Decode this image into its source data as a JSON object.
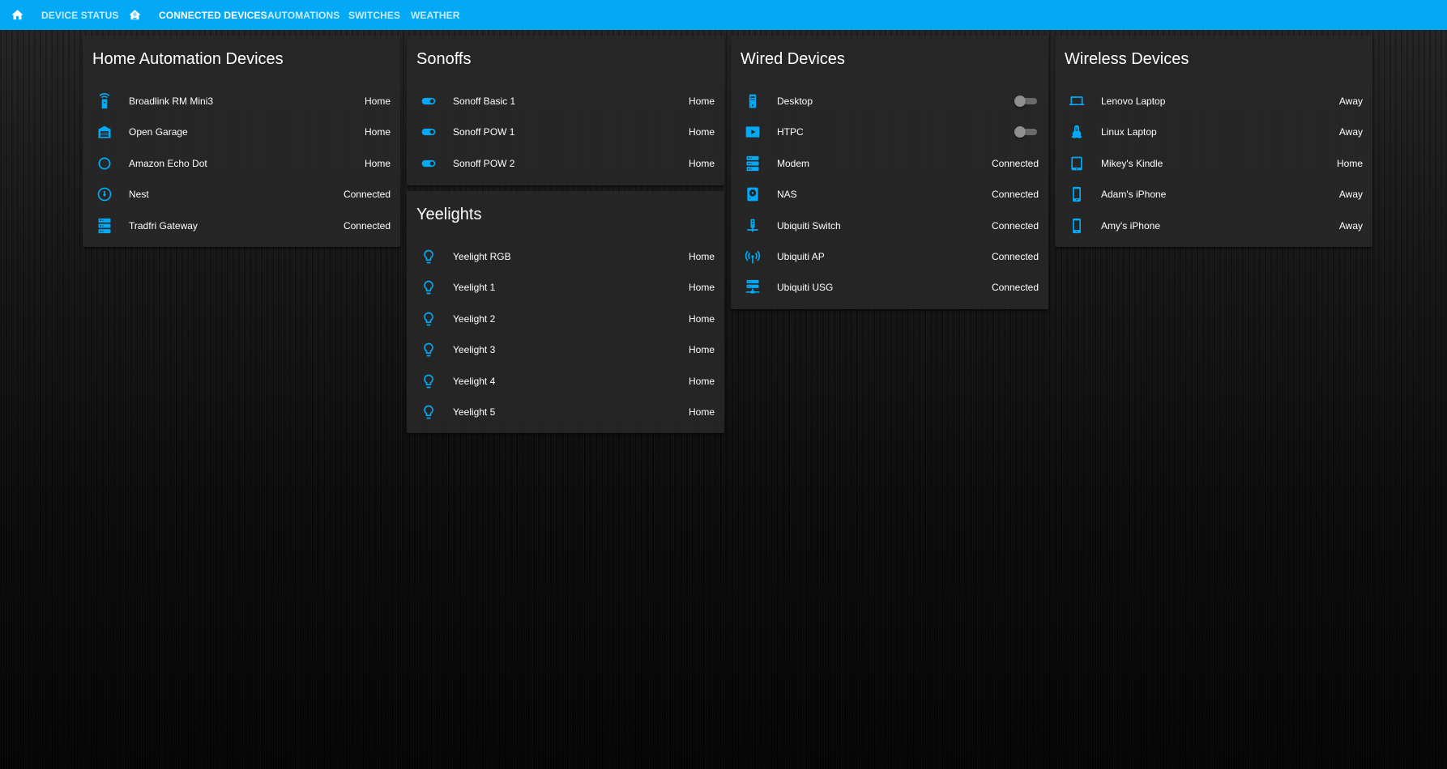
{
  "colors": {
    "accent": "#03a9f4",
    "card_bg": "#282828",
    "text": "#ffffff"
  },
  "toolbar": {
    "home_icon": "home-icon",
    "home_automation_icon": "home-automation-icon",
    "tabs": [
      {
        "label": "DEVICE STATUS"
      },
      {
        "label": "CONNECTED DEVICES",
        "active": true
      },
      {
        "label": "AUTOMATIONS"
      },
      {
        "label": "SWITCHES"
      },
      {
        "label": "WEATHER"
      }
    ]
  },
  "cards": {
    "home_automation": {
      "title": "Home Automation Devices",
      "rows": [
        {
          "icon": "remote-icon",
          "name": "Broadlink RM Mini3",
          "state": "Home"
        },
        {
          "icon": "garage-icon",
          "name": "Open Garage",
          "state": "Home"
        },
        {
          "icon": "amazon-echo-icon",
          "name": "Amazon Echo Dot",
          "state": "Home"
        },
        {
          "icon": "nest-thermostat-icon",
          "name": "Nest",
          "state": "Connected"
        },
        {
          "icon": "server-icon",
          "name": "Tradfri Gateway",
          "state": "Connected"
        }
      ]
    },
    "sonoffs": {
      "title": "Sonoffs",
      "rows": [
        {
          "icon": "toggle-switch-icon",
          "name": "Sonoff Basic 1",
          "state": "Home"
        },
        {
          "icon": "toggle-switch-icon",
          "name": "Sonoff POW 1",
          "state": "Home"
        },
        {
          "icon": "toggle-switch-icon",
          "name": "Sonoff POW 2",
          "state": "Home"
        }
      ]
    },
    "yeelights": {
      "title": "Yeelights",
      "rows": [
        {
          "icon": "lightbulb-icon",
          "name": "Yeelight RGB",
          "state": "Home"
        },
        {
          "icon": "lightbulb-icon",
          "name": "Yeelight 1",
          "state": "Home"
        },
        {
          "icon": "lightbulb-icon",
          "name": "Yeelight 2",
          "state": "Home"
        },
        {
          "icon": "lightbulb-icon",
          "name": "Yeelight 3",
          "state": "Home"
        },
        {
          "icon": "lightbulb-icon",
          "name": "Yeelight 4",
          "state": "Home"
        },
        {
          "icon": "lightbulb-icon",
          "name": "Yeelight 5",
          "state": "Home"
        }
      ]
    },
    "wired": {
      "title": "Wired Devices",
      "rows": [
        {
          "icon": "desktop-tower-icon",
          "name": "Desktop",
          "switch_on": false
        },
        {
          "icon": "play-box-icon",
          "name": "HTPC",
          "switch_on": false
        },
        {
          "icon": "server-icon",
          "name": "Modem",
          "state": "Connected"
        },
        {
          "icon": "nas-harddisk-icon",
          "name": "NAS",
          "state": "Connected"
        },
        {
          "icon": "network-switch-icon",
          "name": "Ubiquiti Switch",
          "state": "Connected"
        },
        {
          "icon": "access-point-icon",
          "name": "Ubiquiti AP",
          "state": "Connected"
        },
        {
          "icon": "server-network-icon",
          "name": "Ubiquiti USG",
          "state": "Connected"
        }
      ]
    },
    "wireless": {
      "title": "Wireless Devices",
      "rows": [
        {
          "icon": "laptop-icon",
          "name": "Lenovo Laptop",
          "state": "Away"
        },
        {
          "icon": "linux-penguin-icon",
          "name": "Linux Laptop",
          "state": "Away"
        },
        {
          "icon": "tablet-icon",
          "name": "Mikey's Kindle",
          "state": "Home"
        },
        {
          "icon": "cellphone-icon",
          "name": "Adam's iPhone",
          "state": "Away"
        },
        {
          "icon": "cellphone-icon",
          "name": "Amy's iPhone",
          "state": "Away"
        }
      ]
    }
  }
}
